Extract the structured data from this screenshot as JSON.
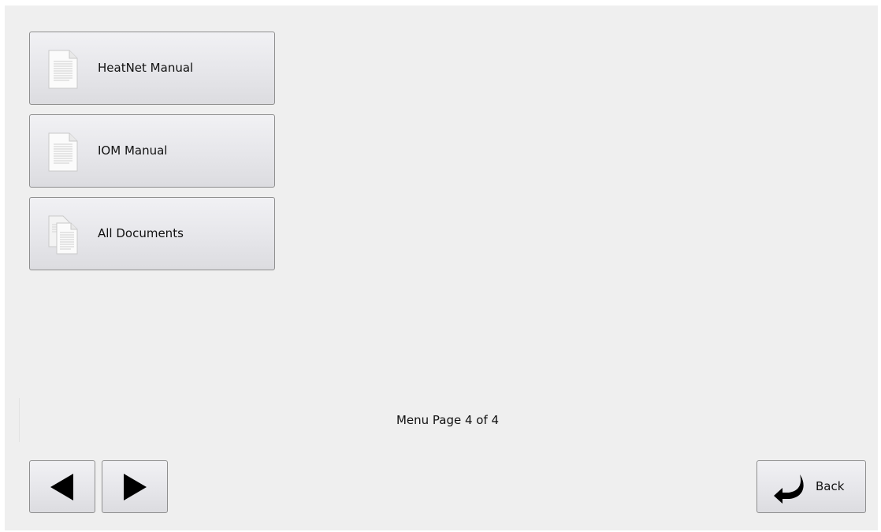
{
  "menu": {
    "items": [
      {
        "label": "HeatNet Manual",
        "icon": "document-icon"
      },
      {
        "label": "IOM Manual",
        "icon": "document-icon"
      },
      {
        "label": "All Documents",
        "icon": "documents-stack-icon"
      }
    ]
  },
  "footer": {
    "page_indicator": "Menu Page 4 of 4",
    "back_label": "Back",
    "prev_icon": "triangle-left-icon",
    "next_icon": "triangle-right-icon",
    "back_icon": "return-arrow-icon"
  }
}
